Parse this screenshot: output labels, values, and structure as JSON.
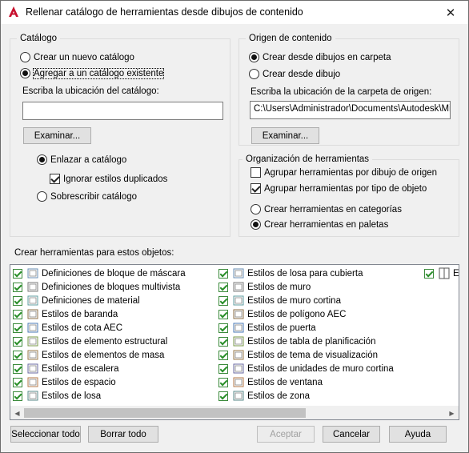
{
  "window": {
    "title": "Rellenar catálogo de herramientas desde dibujos de contenido",
    "close": "✕"
  },
  "catalog": {
    "group_title": "Catálogo",
    "new_catalog": "Crear un nuevo catálogo",
    "append_catalog": "Agregar a un catálogo existente",
    "location_label": "Escriba la ubicación del catálogo:",
    "location_value": "",
    "browse": "Examinar...",
    "link_catalog": "Enlazar a catálogo",
    "ignore_duplicates": "Ignorar estilos duplicados",
    "overwrite_catalog": "Sobrescribir catálogo"
  },
  "source": {
    "group_title": "Origen de contenido",
    "from_folder": "Crear desde dibujos en carpeta",
    "from_drawing": "Crear desde dibujo",
    "folder_label": "Escriba la ubicación de la carpeta de origen:",
    "folder_value": "C:\\Users\\Administrador\\Documents\\Autodesk\\Mis p",
    "browse": "Examinar..."
  },
  "organization": {
    "group_title": "Organización de herramientas",
    "group_by_drawing": "Agrupar herramientas por dibujo de origen",
    "group_by_type": "Agrupar herramientas por tipo de objeto",
    "in_categories": "Crear herramientas en categorías",
    "in_palettes": "Crear herramientas en paletas"
  },
  "objects": {
    "label": "Crear herramientas para estos objetos:",
    "col1": [
      "Definiciones de bloque de máscara",
      "Definiciones de bloques multivista",
      "Definiciones de material",
      "Estilos de baranda",
      "Estilos de cota AEC",
      "Estilos de elemento estructural",
      "Estilos de elementos de masa",
      "Estilos de escalera",
      "Estilos de espacio",
      "Estilos de losa"
    ],
    "col2": [
      "Estilos de losa para cubierta",
      "Estilos de muro",
      "Estilos de muro cortina",
      "Estilos de polígono AEC",
      "Estilos de puerta",
      "Estilos de tabla de planificación",
      "Estilos de tema de visualización",
      "Estilos de unidades de muro cortina",
      "Estilos de ventana",
      "Estilos de zona"
    ],
    "col3": [
      "Es"
    ]
  },
  "buttons": {
    "select_all": "Seleccionar todo",
    "clear_all": "Borrar todo",
    "ok": "Aceptar",
    "cancel": "Cancelar",
    "help": "Ayuda"
  }
}
